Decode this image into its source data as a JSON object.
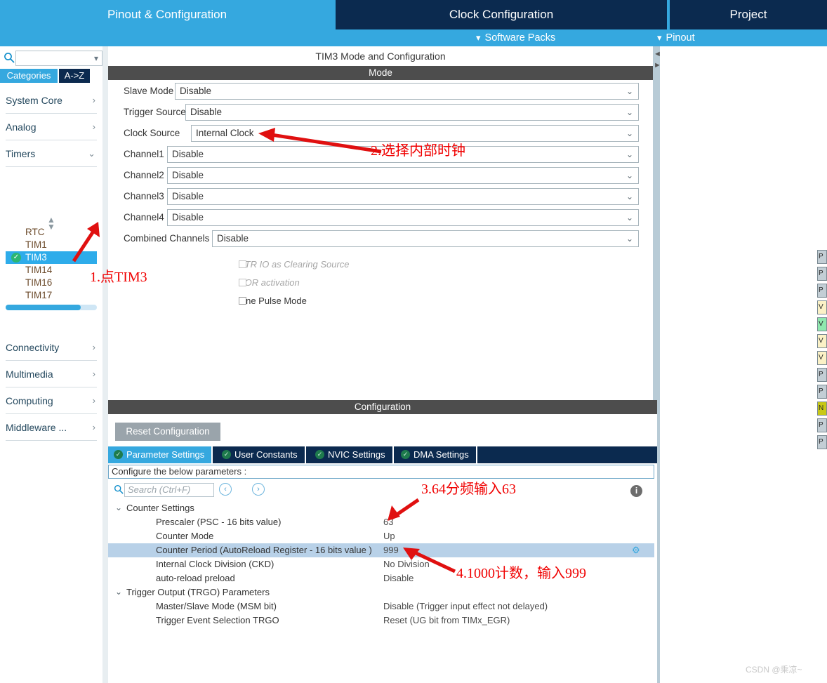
{
  "topbar": {
    "tabs": [
      {
        "label": "Pinout & Configuration",
        "active": true
      },
      {
        "label": "Clock Configuration",
        "active": false
      },
      {
        "label": "Project",
        "active": false
      }
    ],
    "subitems": [
      {
        "label": "Software Packs",
        "icon": "chevron-down-icon"
      },
      {
        "label": "Pinout",
        "icon": "chevron-down-icon"
      }
    ],
    "colors": {
      "accent": "#35a8df",
      "dark": "#0b2a4f"
    }
  },
  "sidebar": {
    "search": {
      "value": "",
      "placeholder": ""
    },
    "view_tabs": [
      {
        "label": "Categories",
        "active": true
      },
      {
        "label": "A->Z",
        "active": false
      }
    ],
    "groups_top": [
      {
        "label": "System Core",
        "chevron": ">"
      },
      {
        "label": "Analog",
        "chevron": ">"
      },
      {
        "label": "Timers",
        "chevron": "v"
      }
    ],
    "timers": [
      {
        "label": "RTC",
        "selected": false,
        "configured": false
      },
      {
        "label": "TIM1",
        "selected": false,
        "configured": false
      },
      {
        "label": "TIM3",
        "selected": true,
        "configured": true
      },
      {
        "label": "TIM14",
        "selected": false,
        "configured": false
      },
      {
        "label": "TIM16",
        "selected": false,
        "configured": false
      },
      {
        "label": "TIM17",
        "selected": false,
        "configured": false
      }
    ],
    "groups_bottom": [
      {
        "label": "Connectivity",
        "chevron": ">"
      },
      {
        "label": "Multimedia",
        "chevron": ">"
      },
      {
        "label": "Computing",
        "chevron": ">"
      },
      {
        "label": "Middleware ...",
        "chevron": ">"
      }
    ]
  },
  "mode_panel": {
    "title": "TIM3 Mode and Configuration",
    "section_title": "Mode",
    "rows": [
      {
        "label": "Slave Mode",
        "value": "Disable"
      },
      {
        "label": "Trigger Source",
        "value": "Disable"
      },
      {
        "label": "Clock Source",
        "value": "Internal Clock"
      },
      {
        "label": "Channel1",
        "value": "Disable"
      },
      {
        "label": "Channel2",
        "value": "Disable"
      },
      {
        "label": "Channel3",
        "value": "Disable"
      },
      {
        "label": "Channel4",
        "value": "Disable"
      },
      {
        "label": "Combined Channels",
        "value": "Disable"
      }
    ],
    "checkboxes": [
      {
        "label": "ETR IO as Clearing Source",
        "checked": false,
        "disabled": true
      },
      {
        "label": "XOR activation",
        "checked": false,
        "disabled": true
      },
      {
        "label": "One Pulse Mode",
        "checked": false,
        "disabled": false
      }
    ]
  },
  "config_panel": {
    "section_title": "Configuration",
    "reset_label": "Reset Configuration",
    "tabs": [
      {
        "label": "Parameter Settings",
        "active": true
      },
      {
        "label": "User Constants",
        "active": false
      },
      {
        "label": "NVIC Settings",
        "active": false
      },
      {
        "label": "DMA Settings",
        "active": false
      }
    ],
    "hint": "Configure the below parameters :",
    "search": {
      "value": "",
      "placeholder": "Search (Ctrl+F)"
    },
    "nav_prev": "‹",
    "nav_next": "›",
    "tree": [
      {
        "type": "group",
        "name": "Counter Settings",
        "chevron": "v",
        "value": ""
      },
      {
        "type": "item",
        "name": "Prescaler (PSC - 16 bits value)",
        "value": "63"
      },
      {
        "type": "item",
        "name": "Counter Mode",
        "value": "Up"
      },
      {
        "type": "item",
        "name": "Counter Period (AutoReload Register - 16 bits value )",
        "value": "999",
        "highlighted": true,
        "gear": true
      },
      {
        "type": "item",
        "name": "Internal Clock Division (CKD)",
        "value": "No Division"
      },
      {
        "type": "item",
        "name": "auto-reload preload",
        "value": "Disable"
      },
      {
        "type": "group",
        "name": "Trigger Output (TRGO) Parameters",
        "chevron": "v",
        "value": ""
      },
      {
        "type": "item",
        "name": "Master/Slave Mode (MSM bit)",
        "value": "Disable (Trigger input effect not delayed)"
      },
      {
        "type": "item",
        "name": "Trigger Event Selection TRGO",
        "value": "Reset (UG bit from TIMx_EGR)"
      }
    ]
  },
  "right_panel": {
    "pins": [
      {
        "text": "P",
        "color": "#c3ced5"
      },
      {
        "text": "P",
        "color": "#c3ced5"
      },
      {
        "text": "P",
        "color": "#c3ced5"
      },
      {
        "text": "V",
        "color": "#fbf1c6"
      },
      {
        "text": "V",
        "color": "#8fe8ae"
      },
      {
        "text": "V",
        "color": "#fbf1c6"
      },
      {
        "text": "V",
        "color": "#fbf1c6"
      },
      {
        "text": "P",
        "color": "#c3ced5"
      },
      {
        "text": "P",
        "color": "#c3ced5"
      },
      {
        "text": "N",
        "color": "#c8c816"
      },
      {
        "text": "P",
        "color": "#c3ced5"
      },
      {
        "text": "P",
        "color": "#c3ced5"
      }
    ]
  },
  "annotations": [
    {
      "id": "step1",
      "text": "1.点TIM3"
    },
    {
      "id": "step2",
      "text": "2.选择内部时钟"
    },
    {
      "id": "step3",
      "text": "3.64分频输入63"
    },
    {
      "id": "step4",
      "text": "4.1000计数，输入999"
    }
  ],
  "watermark": "CSDN @乘凉~"
}
